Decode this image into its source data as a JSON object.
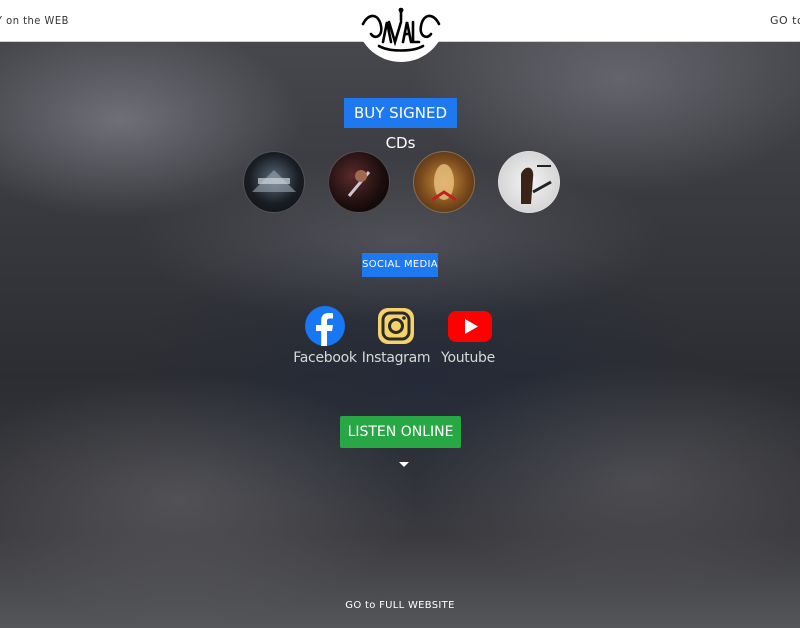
{
  "topbar": {
    "left_text": "Y on the WEB",
    "right_text": "GO to"
  },
  "buy": {
    "label": "BUY SIGNED CDs"
  },
  "albums": [
    {
      "name": "album-1"
    },
    {
      "name": "album-2"
    },
    {
      "name": "album-3"
    },
    {
      "name": "album-4"
    }
  ],
  "social": {
    "label": "SOCIAL MEDIA",
    "items": [
      {
        "label": "Facebook",
        "icon": "facebook-icon",
        "color": "#1877f2"
      },
      {
        "label": "Instagram",
        "icon": "instagram-icon",
        "color": "#f5d36b"
      },
      {
        "label": "Youtube",
        "icon": "youtube-icon",
        "color": "#ff0000"
      }
    ]
  },
  "listen": {
    "label": "LISTEN ONLINE"
  },
  "footer": {
    "link": "GO to FULL WEBSITE"
  },
  "colors": {
    "accent_blue": "#1e78f0",
    "accent_green": "#28a745"
  }
}
